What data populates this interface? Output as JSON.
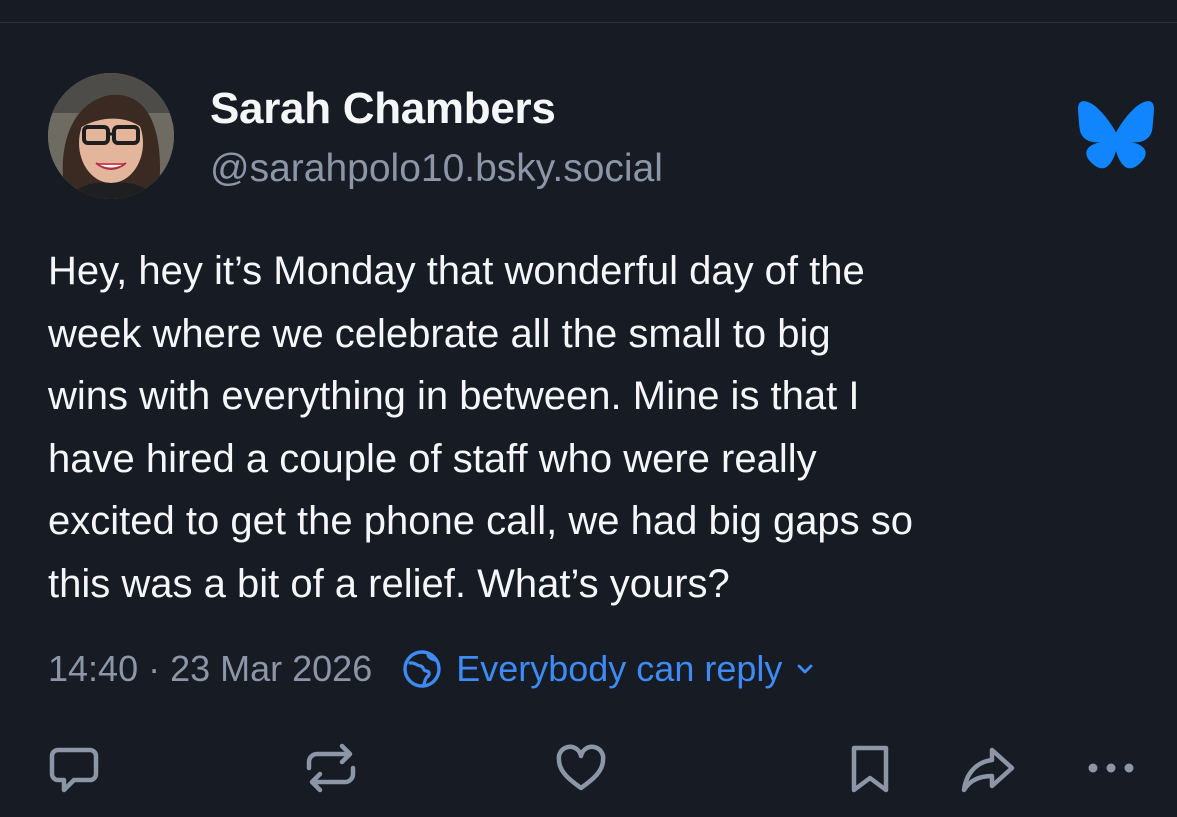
{
  "post": {
    "author": {
      "display_name": "Sarah Chambers",
      "handle": "@sarahpolo10.bsky.social"
    },
    "text_lines": [
      "Hey, hey it’s Monday that wonderful day of the",
      "week where we celebrate all the small to big",
      "wins with everything in between. Mine is that I",
      "have hired a couple of staff who were really",
      "excited to get the phone call, we had big gaps so",
      "this was a bit of a relief. What’s yours?"
    ],
    "timestamp": "14:40 · 23 Mar 2026",
    "reply_setting": "Everybody can reply"
  },
  "icons": {
    "brand": "bluesky-butterfly-icon",
    "reply_setting": "globe-icon",
    "dropdown": "chevron-down-icon",
    "actions": [
      "reply-icon",
      "repost-icon",
      "like-icon",
      "bookmark-icon",
      "share-icon",
      "more-icon"
    ]
  },
  "colors": {
    "background": "#161b24",
    "text": "#f4f6f8",
    "muted": "#8c96a6",
    "accent": "#3e8bf5",
    "brand": "#1185fe"
  }
}
